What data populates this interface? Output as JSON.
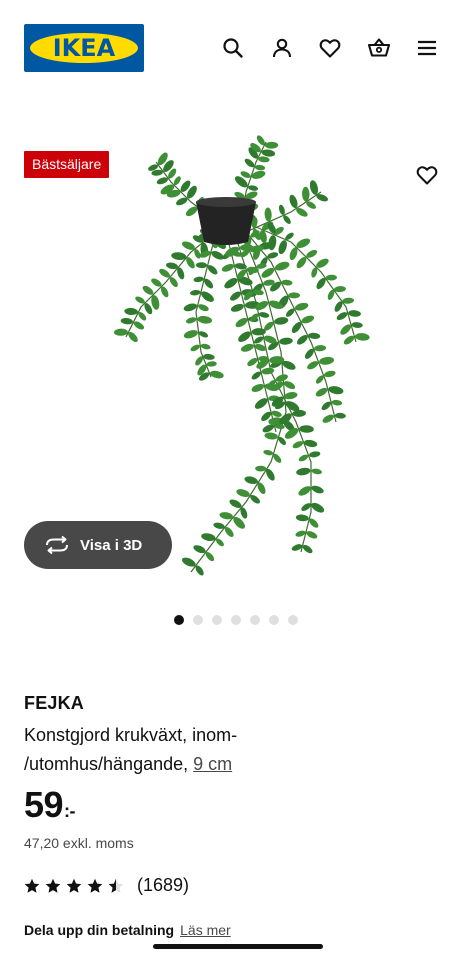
{
  "header": {
    "logo_text": "IKEA",
    "icons": [
      "search-icon",
      "profile-icon",
      "heart-icon",
      "cart-icon",
      "menu-icon"
    ]
  },
  "gallery": {
    "badge": "Bästsäljare",
    "view_3d_label": "Visa i 3D",
    "dots_total": 7,
    "dots_active": 0
  },
  "product": {
    "name": "FEJKA",
    "description_line1": "Konstgjord krukväxt, inom-",
    "description_line2": "/utomhus/hängande,",
    "size_link": "9 cm",
    "price": "59",
    "price_suffix": ":-",
    "ex_vat": "47,20 exkl. moms",
    "rating_stars": 4.5,
    "rating_count": "(1689)",
    "payment_label": "Dela upp din betalning",
    "payment_link": "Läs mer"
  },
  "colors": {
    "ikea_blue": "#0058a3",
    "ikea_yellow": "#ffdb00",
    "badge_red": "#cc0008",
    "button_gray": "#484848",
    "plant_green": "#2f7a2f"
  }
}
